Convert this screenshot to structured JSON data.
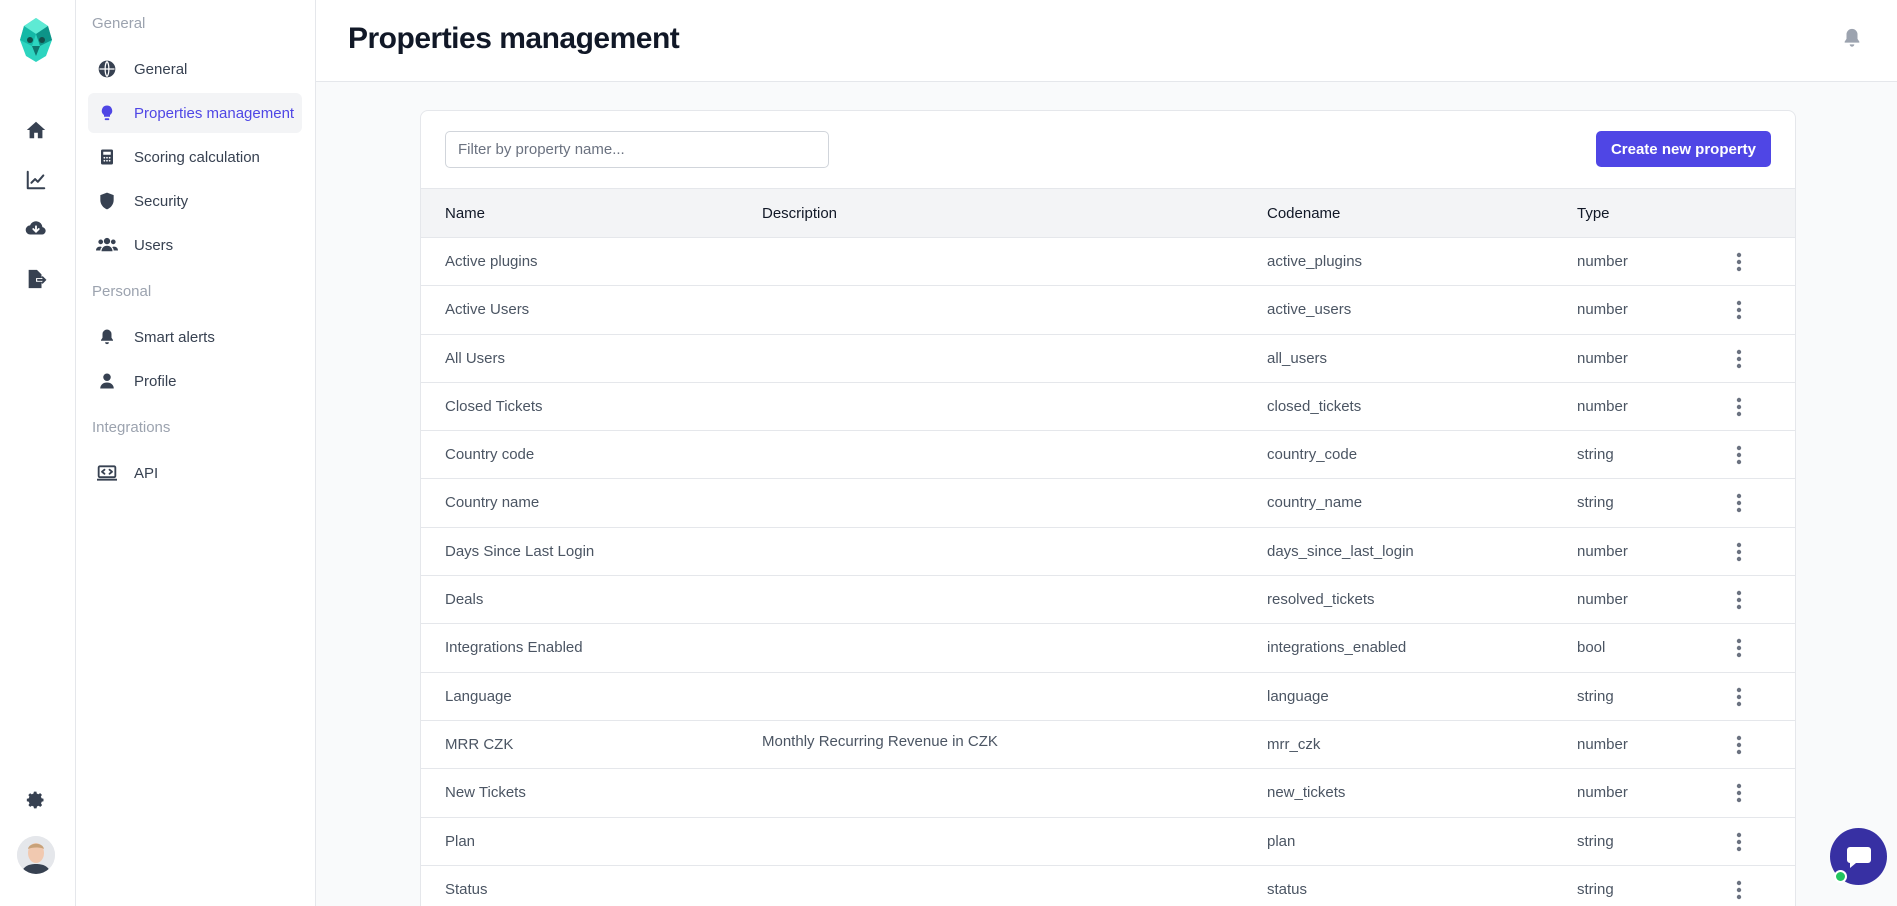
{
  "header": {
    "title": "Properties management"
  },
  "sidebar": {
    "sections": [
      {
        "label": "General",
        "items": [
          {
            "label": "General",
            "icon": "globe-icon"
          },
          {
            "label": "Properties management",
            "icon": "lightbulb-icon",
            "active": true
          },
          {
            "label": "Scoring calculation",
            "icon": "calculator-icon"
          },
          {
            "label": "Security",
            "icon": "shield-icon"
          },
          {
            "label": "Users",
            "icon": "users-icon"
          }
        ]
      },
      {
        "label": "Personal",
        "items": [
          {
            "label": "Smart alerts",
            "icon": "bell-icon"
          },
          {
            "label": "Profile",
            "icon": "user-icon"
          }
        ]
      },
      {
        "label": "Integrations",
        "items": [
          {
            "label": "API",
            "icon": "code-icon"
          }
        ]
      }
    ]
  },
  "rail": {
    "icons": [
      "home-icon",
      "chart-line-icon",
      "cloud-download-icon",
      "export-file-icon",
      "gear-icon"
    ]
  },
  "toolbar": {
    "filter_placeholder": "Filter by property name...",
    "create_label": "Create new property"
  },
  "table": {
    "columns": {
      "name": "Name",
      "description": "Description",
      "codename": "Codename",
      "type": "Type"
    },
    "rows": [
      {
        "name": "Active plugins",
        "description": "",
        "codename": "active_plugins",
        "type": "number"
      },
      {
        "name": "Active Users",
        "description": "",
        "codename": "active_users",
        "type": "number"
      },
      {
        "name": "All Users",
        "description": "",
        "codename": "all_users",
        "type": "number"
      },
      {
        "name": "Closed Tickets",
        "description": "",
        "codename": "closed_tickets",
        "type": "number"
      },
      {
        "name": "Country code",
        "description": "",
        "codename": "country_code",
        "type": "string"
      },
      {
        "name": "Country name",
        "description": "",
        "codename": "country_name",
        "type": "string"
      },
      {
        "name": "Days Since Last Login",
        "description": "",
        "codename": "days_since_last_login",
        "type": "number"
      },
      {
        "name": "Deals",
        "description": "",
        "codename": "resolved_tickets",
        "type": "number"
      },
      {
        "name": "Integrations Enabled",
        "description": "",
        "codename": "integrations_enabled",
        "type": "bool"
      },
      {
        "name": "Language",
        "description": "",
        "codename": "language",
        "type": "string"
      },
      {
        "name": "MRR CZK",
        "description": "Monthly Recurring Revenue in CZK",
        "codename": "mrr_czk",
        "type": "number"
      },
      {
        "name": "New Tickets",
        "description": "",
        "codename": "new_tickets",
        "type": "number"
      },
      {
        "name": "Plan",
        "description": "",
        "codename": "plan",
        "type": "string"
      },
      {
        "name": "Status",
        "description": "",
        "codename": "status",
        "type": "string"
      }
    ]
  },
  "colors": {
    "accent": "#4f46e5",
    "brand_logo": "#2dd4bf",
    "chat": "#3730a3",
    "online": "#22c55e"
  }
}
